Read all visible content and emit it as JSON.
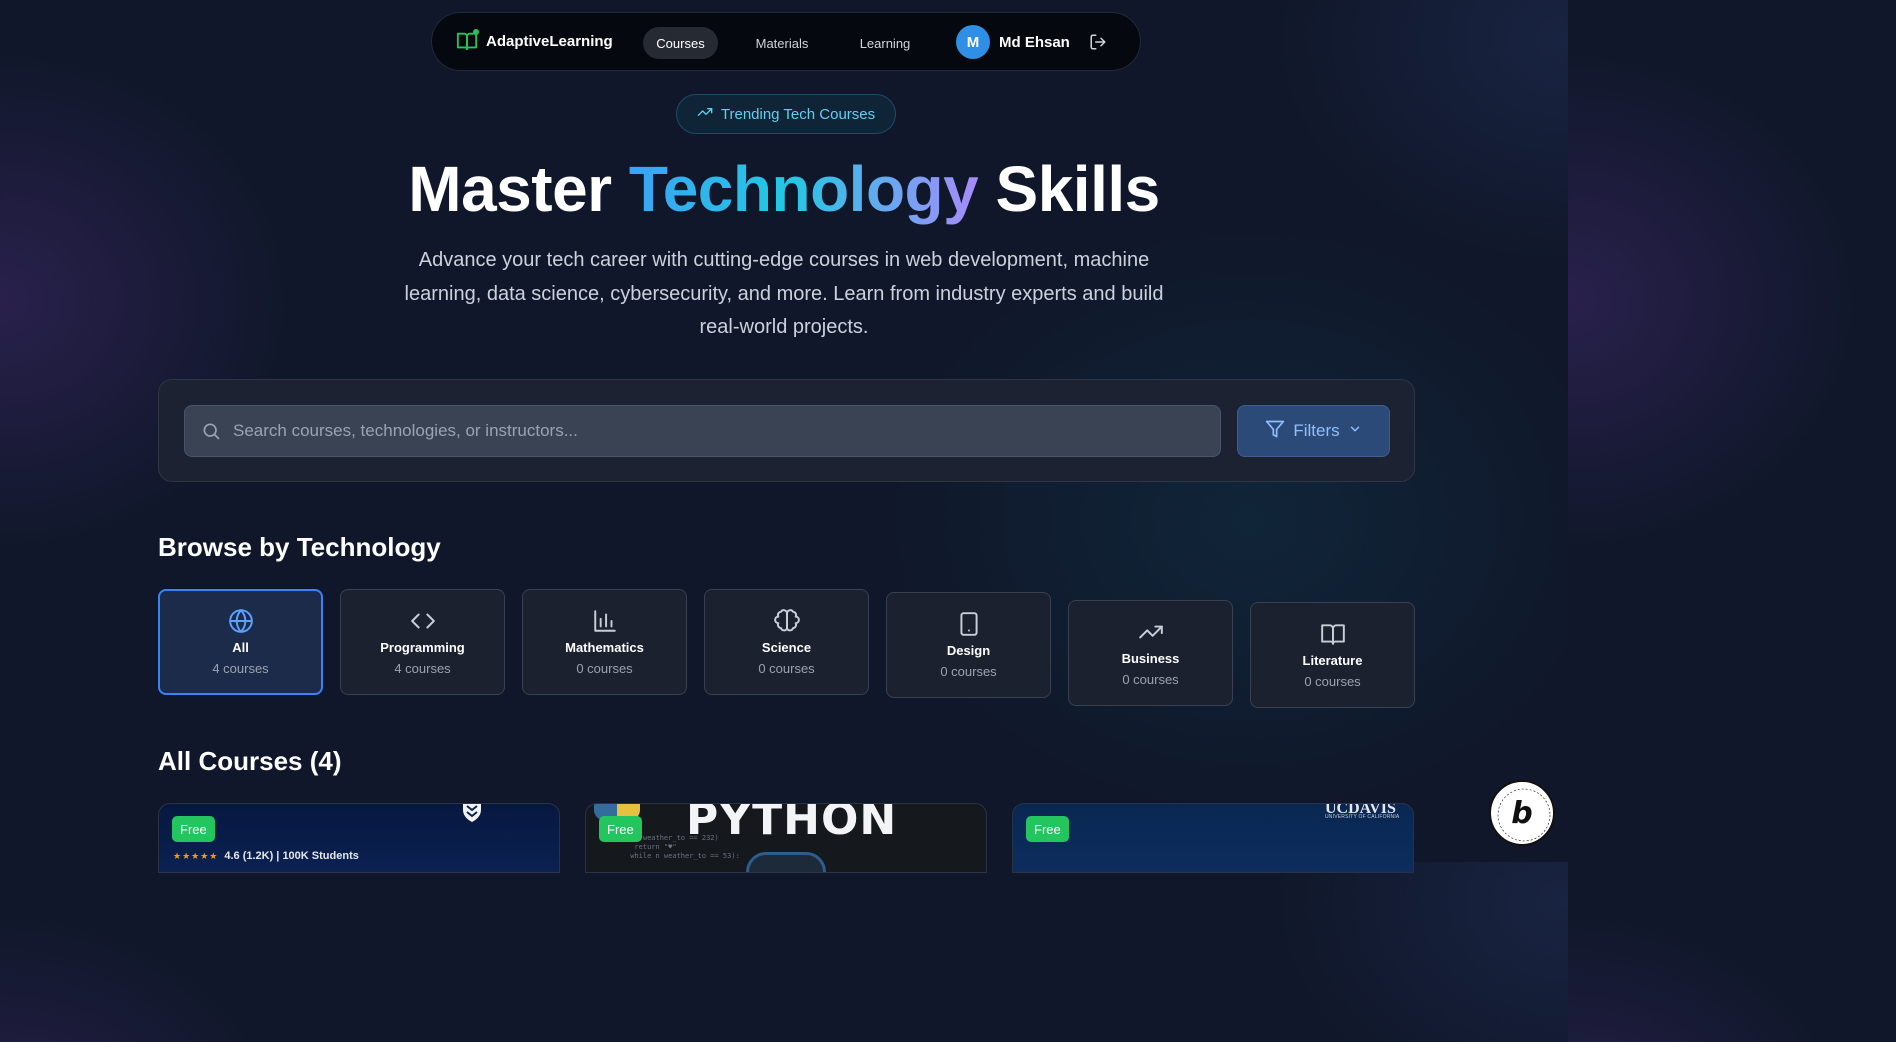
{
  "nav": {
    "brand": "AdaptiveLearning",
    "links": [
      {
        "label": "Courses",
        "active": true
      },
      {
        "label": "Materials",
        "active": false
      },
      {
        "label": "Learning",
        "active": false
      }
    ],
    "user": {
      "initial": "M",
      "name": "Md Ehsan"
    }
  },
  "badge": {
    "label": "Trending Tech Courses"
  },
  "hero": {
    "title_start": "Master ",
    "title_highlight": "Technology",
    "title_end": " Skills",
    "subtitle": "Advance your tech career with cutting-edge courses in web development, machine learning, data science, cybersecurity, and more. Learn from industry experts and build real-world projects."
  },
  "search": {
    "placeholder": "Search courses, technologies, or instructors...",
    "value": "",
    "filters_label": "Filters"
  },
  "browse": {
    "title": "Browse by Technology",
    "categories": [
      {
        "name": "All",
        "count": "4 courses",
        "icon": "globe-icon",
        "active": true
      },
      {
        "name": "Programming",
        "count": "4 courses",
        "icon": "code-icon",
        "active": false
      },
      {
        "name": "Mathematics",
        "count": "0 courses",
        "icon": "bar-chart-icon",
        "active": false
      },
      {
        "name": "Science",
        "count": "0 courses",
        "icon": "brain-icon",
        "active": false
      },
      {
        "name": "Design",
        "count": "0 courses",
        "icon": "tablet-icon",
        "active": false
      },
      {
        "name": "Business",
        "count": "0 courses",
        "icon": "trending-up-icon",
        "active": false
      },
      {
        "name": "Literature",
        "count": "0 courses",
        "icon": "book-open-icon",
        "active": false
      }
    ]
  },
  "courses": {
    "title": "All Courses (4)",
    "items": [
      {
        "badge": "Free",
        "rating": "4.6 (1.2K) | 100K Students",
        "stars": "★★★★★"
      },
      {
        "badge": "Free",
        "banner_text": "PYTHON"
      },
      {
        "badge": "Free",
        "logo_text": "UCDAVIS",
        "logo_sub": "UNIVERSITY OF CALIFORNIA"
      }
    ]
  },
  "colors": {
    "background": "#10172a",
    "accent": "#3b82f6",
    "free_badge": "#22c55e",
    "avatar": "#2f8ee6",
    "trend": "#5fd0f3"
  }
}
